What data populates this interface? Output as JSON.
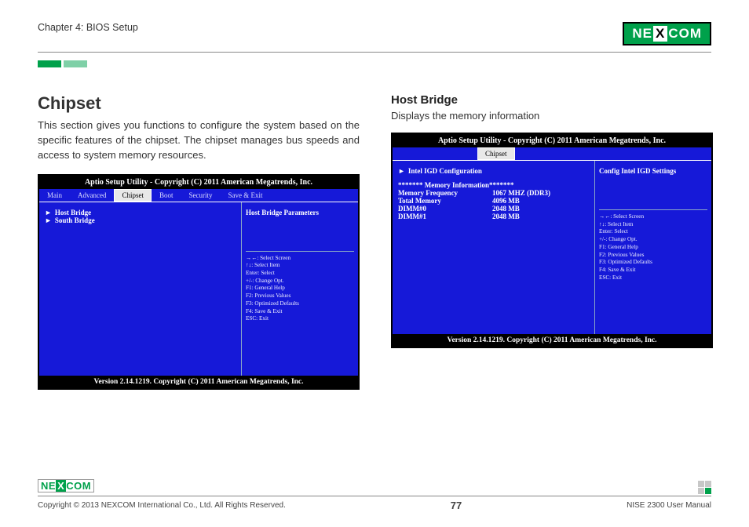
{
  "header": {
    "chapter": "Chapter 4: BIOS Setup",
    "logo": "NEXCOM"
  },
  "left_column": {
    "title": "Chipset",
    "paragraph": "This section gives you functions to configure the system based on the specific features of the chipset. The chipset manages bus speeds and access to system memory resources."
  },
  "right_column": {
    "title": "Host Bridge",
    "paragraph": "Displays the memory information"
  },
  "bios1": {
    "title": "Aptio Setup Utility - Copyright (C) 2011 American Megatrends, Inc.",
    "tabs": [
      "Main",
      "Advanced",
      "Chipset",
      "Boot",
      "Security",
      "Save & Exit"
    ],
    "active_tab": "Chipset",
    "menu_items": [
      "Host Bridge",
      "South Bridge"
    ],
    "right_title": "Host Bridge Parameters",
    "footer": "Version 2.14.1219. Copyright (C) 2011 American Megatrends, Inc."
  },
  "bios2": {
    "title": "Aptio Setup Utility - Copyright (C) 2011 American Megatrends, Inc.",
    "active_tab": "Chipset",
    "menu_items": [
      "Intel IGD Configuration"
    ],
    "info_header": "******* Memory Information*******",
    "info_rows": [
      {
        "label": "Memory Frequency",
        "value": "1067 MHZ (DDR3)"
      },
      {
        "label": "Total Memory",
        "value": "4096 MB"
      },
      {
        "label": "DIMM#0",
        "value": "2048 MB"
      },
      {
        "label": "DIMM#1",
        "value": "2048 MB"
      }
    ],
    "right_title": "Config Intel IGD Settings",
    "footer": "Version 2.14.1219. Copyright (C) 2011 American Megatrends, Inc."
  },
  "help_keys": [
    "→←: Select Screen",
    "↑↓: Select Item",
    "Enter: Select",
    "+/-: Change Opt.",
    "F1: General Help",
    "F2: Previous Values",
    "F3: Optimized Defaults",
    "F4: Save & Exit",
    "ESC: Exit"
  ],
  "footer": {
    "copyright": "Copyright © 2013 NEXCOM International Co., Ltd. All Rights Reserved.",
    "page": "77",
    "manual": "NISE 2300 User Manual"
  }
}
